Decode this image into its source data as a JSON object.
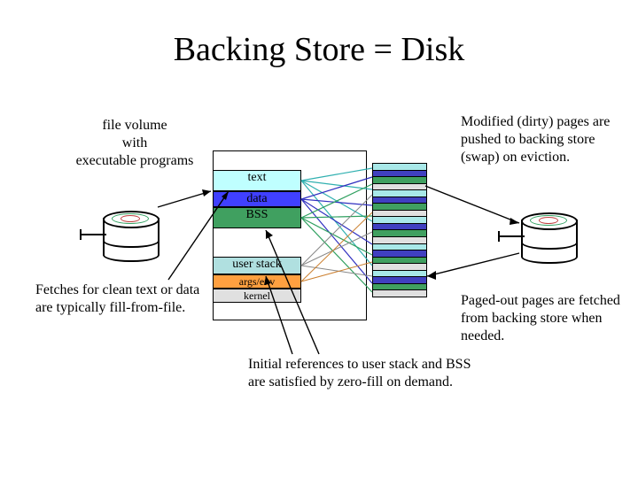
{
  "title": "Backing Store = Disk",
  "notes": {
    "top_left": "file volume\nwith\nexecutable programs",
    "top_right": "Modified (dirty) pages are pushed to backing store (swap) on eviction.",
    "bottom_left": "Fetches for clean text or data are typically fill-from-file.",
    "bottom_right": "Paged-out pages are fetched from backing store when needed.",
    "bottom_mid": "Initial references to user stack and BSS are satisfied by zero-fill on demand."
  },
  "segments": {
    "text": "text",
    "data": "data",
    "bss": "BSS",
    "user_stack": "user stack",
    "args_env": "args/env",
    "kernel": "kernel"
  }
}
